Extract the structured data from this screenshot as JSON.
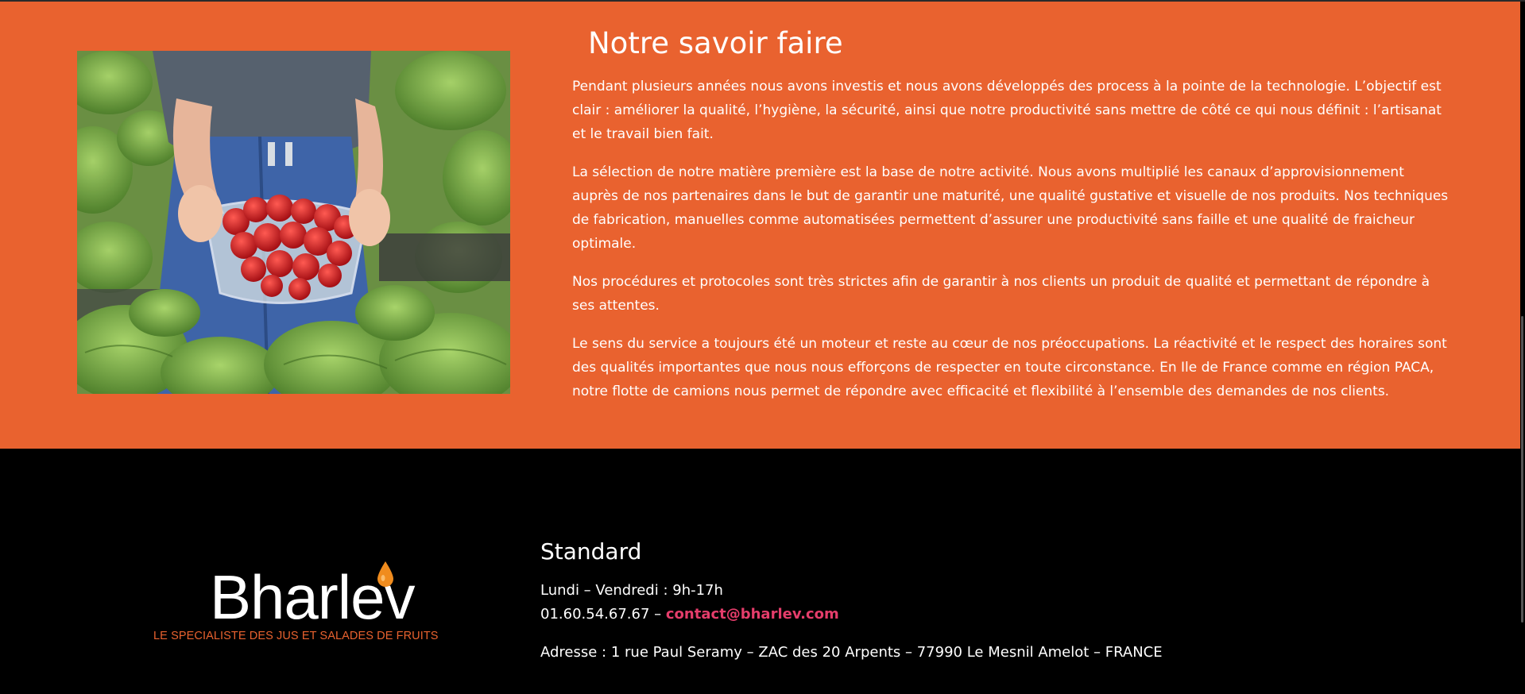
{
  "savoir_faire": {
    "title": "Notre savoir faire",
    "paragraphs": [
      "Pendant plusieurs années nous avons investis et nous avons développés des process à la pointe de la technologie. L’objectif est clair : améliorer la qualité, l’hygiène, la sécurité, ainsi que notre productivité sans mettre de côté ce qui nous définit : l’artisanat et le travail bien fait.",
      "La sélection de notre matière première est la base de notre activité. Nous avons multiplié les canaux d’approvisionnement auprès de nos partenaires dans le but de garantir une maturité, une qualité gustative et visuelle de nos produits. Nos techniques de fabrication, manuelles comme automatisées permettent d’assurer une productivité sans faille et une qualité de fraicheur optimale.",
      "Nos procédures et protocoles sont très strictes afin de garantir à nos clients un produit de qualité et permettant de répondre à ses attentes.",
      "Le sens du service a toujours été un moteur et reste au cœur de nos préoccupations. La réactivité et le respect des horaires sont des qualités importantes que nous nous efforçons de respecter en toute circonstance. En Ile de France comme en région PACA, notre flotte de camions nous permet de répondre avec efficacité et flexibilité à l’ensemble des demandes de nos clients."
    ]
  },
  "footer": {
    "logo": {
      "name": "Bharlev",
      "tagline": "LE SPECIALISTE DES JUS ET SALADES DE FRUITS"
    },
    "contact": {
      "title": "Standard",
      "hours": "Lundi – Vendredi : 9h-17h",
      "phone_prefix": "01.60.54.67.67 – ",
      "email": "contact@bharlev.com",
      "address": "Adresse : 1 rue Paul Seramy – ZAC des 20 Arpents – 77990 Le Mesnil Amelot – FRANCE"
    }
  },
  "colors": {
    "accent": "#e9622f",
    "link": "#e53d6b",
    "footer_bg": "#000000"
  }
}
